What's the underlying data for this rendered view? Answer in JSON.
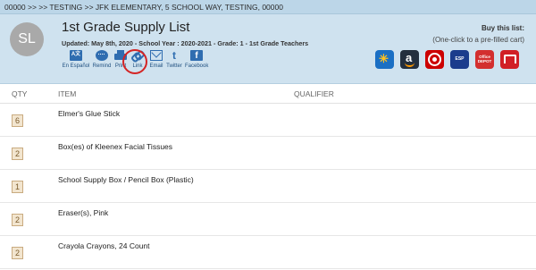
{
  "breadcrumb": "00000 >> >> TESTING >> JFK ELEMENTARY, 5 SCHOOL WAY, TESTING, 00000",
  "header": {
    "avatar_initials": "SL",
    "title": "1st Grade Supply List",
    "meta": "Updated: May 8th, 2020 - School Year : 2020-2021 - Grade: 1 - 1st Grade Teachers"
  },
  "actions": [
    {
      "label": "En Español",
      "icon": "translate-icon"
    },
    {
      "label": "Remind",
      "icon": "remind-icon"
    },
    {
      "label": "Print",
      "icon": "print-icon"
    },
    {
      "label": "Link",
      "icon": "link-icon"
    },
    {
      "label": "Email",
      "icon": "email-icon"
    },
    {
      "label": "Twitter",
      "icon": "twitter-icon"
    },
    {
      "label": "Facebook",
      "icon": "facebook-icon"
    }
  ],
  "buy": {
    "title": "Buy this list:",
    "subtitle": "(One-click to a pre-filled cart)"
  },
  "stores": [
    {
      "name": "walmart",
      "glyph": "✳"
    },
    {
      "name": "amazon",
      "glyph": "a"
    },
    {
      "name": "target",
      "glyph": ""
    },
    {
      "name": "school-supply-store",
      "glyph": "ESP"
    },
    {
      "name": "office-depot",
      "glyph": "Office DEPOT"
    },
    {
      "name": "staples",
      "glyph": ""
    }
  ],
  "columns": {
    "qty": "QTY",
    "item": "ITEM",
    "qualifier": "QUALIFIER"
  },
  "items": [
    {
      "qty": "6",
      "name": "Elmer's Glue Stick"
    },
    {
      "qty": "2",
      "name": "Box(es) of Kleenex Facial Tissues"
    },
    {
      "qty": "1",
      "name": "School Supply Box / Pencil Box (Plastic)"
    },
    {
      "qty": "2",
      "name": "Eraser(s), Pink"
    },
    {
      "qty": "2",
      "name": "Crayola Crayons, 24 Count"
    }
  ],
  "colors": {
    "header_bg": "#cfe2ef",
    "breadcrumb_bg": "#bcd6e8",
    "icon_blue": "#2f6db0",
    "highlight_red": "#d42424",
    "qty_badge_bg": "#f2e5cf"
  }
}
